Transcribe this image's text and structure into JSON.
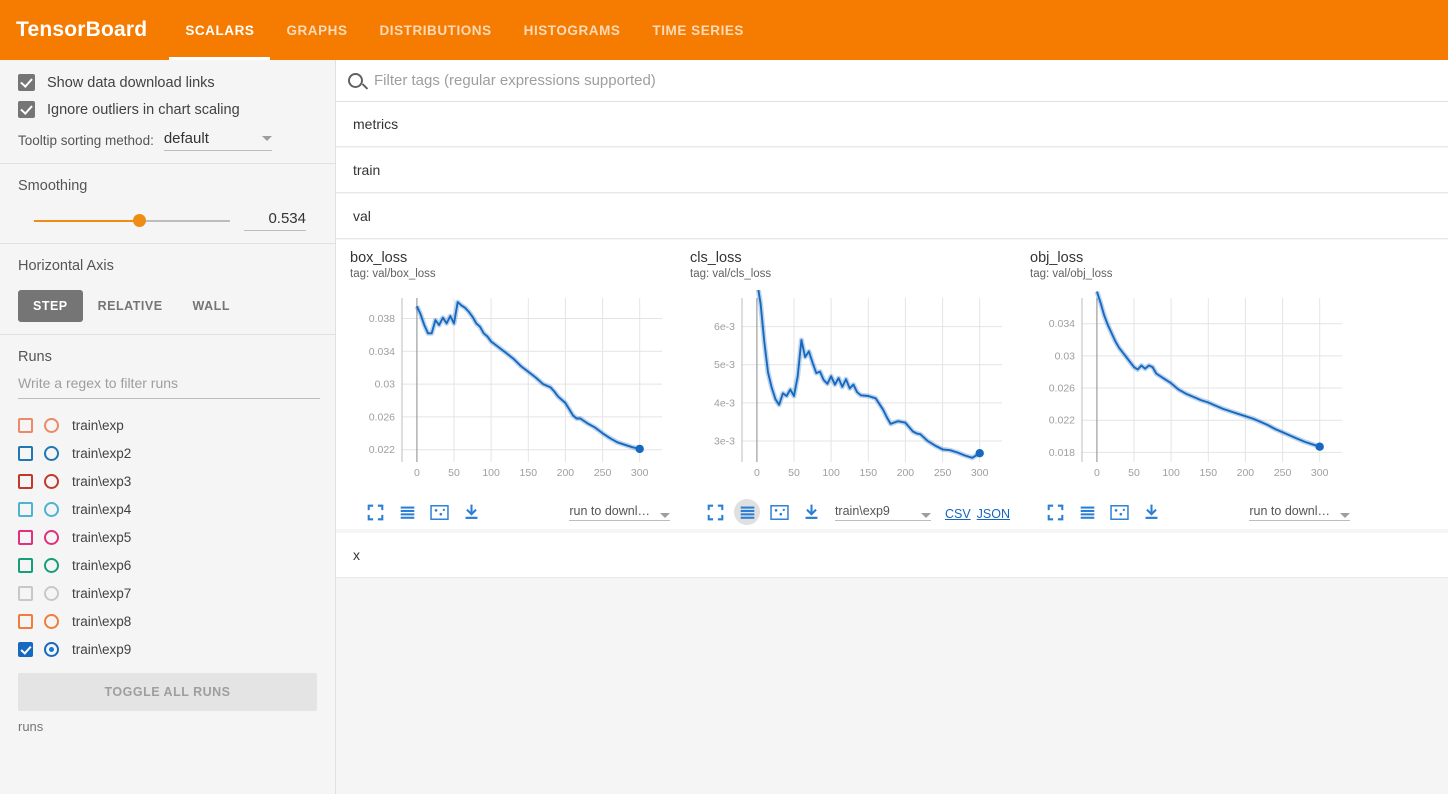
{
  "header": {
    "brand": "TensorBoard",
    "accent_color": "#f57c00",
    "tabs": [
      {
        "label": "SCALARS",
        "active": true
      },
      {
        "label": "GRAPHS",
        "active": false
      },
      {
        "label": "DISTRIBUTIONS",
        "active": false
      },
      {
        "label": "HISTOGRAMS",
        "active": false
      },
      {
        "label": "TIME SERIES",
        "active": false
      }
    ]
  },
  "sidebar": {
    "checkboxes": [
      {
        "label": "Show data download links",
        "checked": true
      },
      {
        "label": "Ignore outliers in chart scaling",
        "checked": true
      }
    ],
    "tooltip": {
      "label": "Tooltip sorting method:",
      "value": "default"
    },
    "smoothing": {
      "title": "Smoothing",
      "value": "0.534",
      "fraction": 0.534
    },
    "horizontal_axis": {
      "title": "Horizontal Axis",
      "options": [
        {
          "label": "STEP",
          "active": true
        },
        {
          "label": "RELATIVE",
          "active": false
        },
        {
          "label": "WALL",
          "active": false
        }
      ]
    },
    "runs": {
      "title": "Runs",
      "filter_placeholder": "Write a regex to filter runs",
      "items": [
        {
          "name": "train\\exp",
          "color": "#ee8866",
          "checked": false,
          "selected": false
        },
        {
          "name": "train\\exp2",
          "color": "#1f77b4",
          "checked": false,
          "selected": false
        },
        {
          "name": "train\\exp3",
          "color": "#c0392b",
          "checked": false,
          "selected": false
        },
        {
          "name": "train\\exp4",
          "color": "#4eb3d3",
          "checked": false,
          "selected": false
        },
        {
          "name": "train\\exp5",
          "color": "#e0307e",
          "checked": false,
          "selected": false
        },
        {
          "name": "train\\exp6",
          "color": "#159e77",
          "checked": false,
          "selected": false
        },
        {
          "name": "train\\exp7",
          "color": "#c8c8c8",
          "checked": false,
          "selected": false
        },
        {
          "name": "train\\exp8",
          "color": "#f07c3e",
          "checked": false,
          "selected": false
        },
        {
          "name": "train\\exp9",
          "color": "#1769c0",
          "checked": true,
          "selected": true
        }
      ],
      "toggle_all_label": "TOGGLE ALL RUNS",
      "footer": "runs"
    }
  },
  "main": {
    "filter_placeholder": "Filter tags (regular expressions supported)",
    "accordions_top": [
      "metrics",
      "train"
    ],
    "open_accordion": "val",
    "accordion_bottom": "x",
    "toolbar_icons": [
      "fullscreen-icon",
      "data-series-icon",
      "fit-domain-icon",
      "download-icon"
    ],
    "download_placeholder": "run to downl…",
    "csv_label": "CSV",
    "json_label": "JSON",
    "selected_run": "train\\exp9"
  },
  "chart_data": [
    {
      "type": "line",
      "title": "box_loss",
      "tag": "tag: val/box_loss",
      "xlabel": "",
      "ylabel": "",
      "xticks": [
        0,
        50,
        100,
        150,
        200,
        250,
        300
      ],
      "yticks": [
        0.022,
        0.026,
        0.03,
        0.034,
        0.038
      ],
      "ytick_labels": [
        "0.022",
        "0.026",
        "0.03",
        "0.034",
        "0.038"
      ],
      "xlim": [
        -20,
        330
      ],
      "ylim": [
        0.0205,
        0.0405
      ],
      "grid": true,
      "legend": false,
      "series": [
        {
          "name": "train\\exp9",
          "color": "#1769c0",
          "x": [
            0,
            5,
            10,
            15,
            20,
            25,
            30,
            35,
            40,
            45,
            50,
            55,
            60,
            65,
            70,
            75,
            80,
            85,
            90,
            95,
            100,
            110,
            120,
            130,
            140,
            150,
            160,
            170,
            180,
            185,
            190,
            200,
            210,
            215,
            220,
            230,
            240,
            250,
            260,
            270,
            280,
            290,
            300
          ],
          "y": [
            0.0395,
            0.0385,
            0.0372,
            0.0362,
            0.0362,
            0.0378,
            0.0372,
            0.0381,
            0.0374,
            0.0383,
            0.0374,
            0.04,
            0.0396,
            0.0393,
            0.0388,
            0.0382,
            0.0374,
            0.037,
            0.0362,
            0.0358,
            0.0352,
            0.0345,
            0.0338,
            0.0331,
            0.0322,
            0.0315,
            0.0308,
            0.03,
            0.0296,
            0.0291,
            0.0285,
            0.0277,
            0.0262,
            0.0258,
            0.0258,
            0.0252,
            0.0247,
            0.024,
            0.0234,
            0.0229,
            0.0226,
            0.0223,
            0.0221
          ]
        }
      ],
      "endpoint": {
        "x": 300,
        "y": 0.0221
      }
    },
    {
      "type": "line",
      "title": "cls_loss",
      "tag": "tag: val/cls_loss",
      "xlabel": "",
      "ylabel": "",
      "xticks": [
        0,
        50,
        100,
        150,
        200,
        250,
        300
      ],
      "yticks": [
        0.003,
        0.004,
        0.005,
        0.006
      ],
      "ytick_labels": [
        "3e-3",
        "4e-3",
        "5e-3",
        "6e-3"
      ],
      "xlim": [
        -20,
        330
      ],
      "ylim": [
        0.00245,
        0.00675
      ],
      "grid": true,
      "legend": false,
      "series": [
        {
          "name": "train\\exp9",
          "color": "#1769c0",
          "x": [
            0,
            5,
            10,
            15,
            20,
            25,
            30,
            35,
            40,
            45,
            50,
            55,
            60,
            65,
            70,
            75,
            80,
            85,
            90,
            95,
            100,
            105,
            110,
            115,
            120,
            125,
            130,
            135,
            140,
            150,
            160,
            170,
            175,
            180,
            190,
            200,
            210,
            215,
            220,
            230,
            240,
            250,
            260,
            270,
            280,
            290,
            300
          ],
          "y": [
            0.0072,
            0.0066,
            0.0056,
            0.0048,
            0.0044,
            0.0041,
            0.00395,
            0.00425,
            0.00418,
            0.00435,
            0.00418,
            0.0047,
            0.00565,
            0.0052,
            0.00535,
            0.00505,
            0.00478,
            0.00482,
            0.0046,
            0.0045,
            0.0047,
            0.00448,
            0.00465,
            0.00442,
            0.00462,
            0.00438,
            0.00448,
            0.00428,
            0.0042,
            0.00418,
            0.00412,
            0.00382,
            0.00362,
            0.00345,
            0.00352,
            0.00348,
            0.00325,
            0.0032,
            0.00318,
            0.003,
            0.00288,
            0.00278,
            0.00276,
            0.0027,
            0.00262,
            0.00256,
            0.00268
          ]
        }
      ],
      "endpoint": {
        "x": 300,
        "y": 0.00268
      }
    },
    {
      "type": "line",
      "title": "obj_loss",
      "tag": "tag: val/obj_loss",
      "xlabel": "",
      "ylabel": "",
      "xticks": [
        0,
        50,
        100,
        150,
        200,
        250,
        300
      ],
      "yticks": [
        0.018,
        0.022,
        0.026,
        0.03,
        0.034
      ],
      "ytick_labels": [
        "0.018",
        "0.022",
        "0.026",
        "0.03",
        "0.034"
      ],
      "xlim": [
        -20,
        330
      ],
      "ylim": [
        0.0168,
        0.0372
      ],
      "grid": true,
      "legend": false,
      "series": [
        {
          "name": "train\\exp9",
          "color": "#1769c0",
          "x": [
            0,
            5,
            10,
            15,
            20,
            25,
            30,
            35,
            40,
            45,
            50,
            55,
            60,
            65,
            70,
            75,
            80,
            85,
            90,
            100,
            110,
            120,
            130,
            140,
            150,
            160,
            170,
            180,
            190,
            200,
            210,
            220,
            230,
            240,
            250,
            260,
            270,
            280,
            290,
            300
          ],
          "y": [
            0.038,
            0.0366,
            0.035,
            0.0338,
            0.0328,
            0.0318,
            0.031,
            0.0304,
            0.0298,
            0.0292,
            0.0286,
            0.0283,
            0.0288,
            0.0284,
            0.0288,
            0.0286,
            0.0278,
            0.0275,
            0.0272,
            0.0266,
            0.0258,
            0.0253,
            0.0249,
            0.0245,
            0.0242,
            0.0238,
            0.0234,
            0.0231,
            0.0228,
            0.0225,
            0.0222,
            0.0218,
            0.0214,
            0.0209,
            0.0205,
            0.0201,
            0.0197,
            0.0193,
            0.019,
            0.0187
          ]
        }
      ],
      "endpoint": {
        "x": 300,
        "y": 0.0187
      }
    }
  ]
}
